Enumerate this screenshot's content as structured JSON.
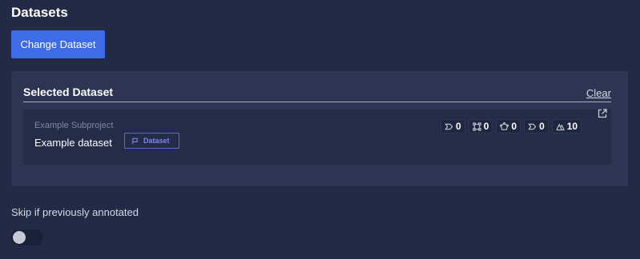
{
  "page": {
    "title": "Datasets"
  },
  "actions": {
    "change_dataset_label": "Change Dataset"
  },
  "selected": {
    "title": "Selected Dataset",
    "clear_label": "Clear",
    "dataset": {
      "subproject": "Example Subproject",
      "name": "Example dataset",
      "badge_label": "Dataset",
      "badge_icon": "flag-icon",
      "open_icon": "external-link-icon",
      "stats": [
        {
          "icon": "tag-icon",
          "value": "0"
        },
        {
          "icon": "bounding-box-icon",
          "value": "0"
        },
        {
          "icon": "polygon-icon",
          "value": "0"
        },
        {
          "icon": "label-icon",
          "value": "0"
        },
        {
          "icon": "image-icon",
          "value": "10"
        }
      ]
    }
  },
  "skip": {
    "label": "Skip if previously annotated",
    "enabled": false
  },
  "colors": {
    "background": "#232a45",
    "panel": "#2d3553",
    "card": "#252c48",
    "accent": "#3e6be6",
    "badge": "#7f86f0"
  }
}
